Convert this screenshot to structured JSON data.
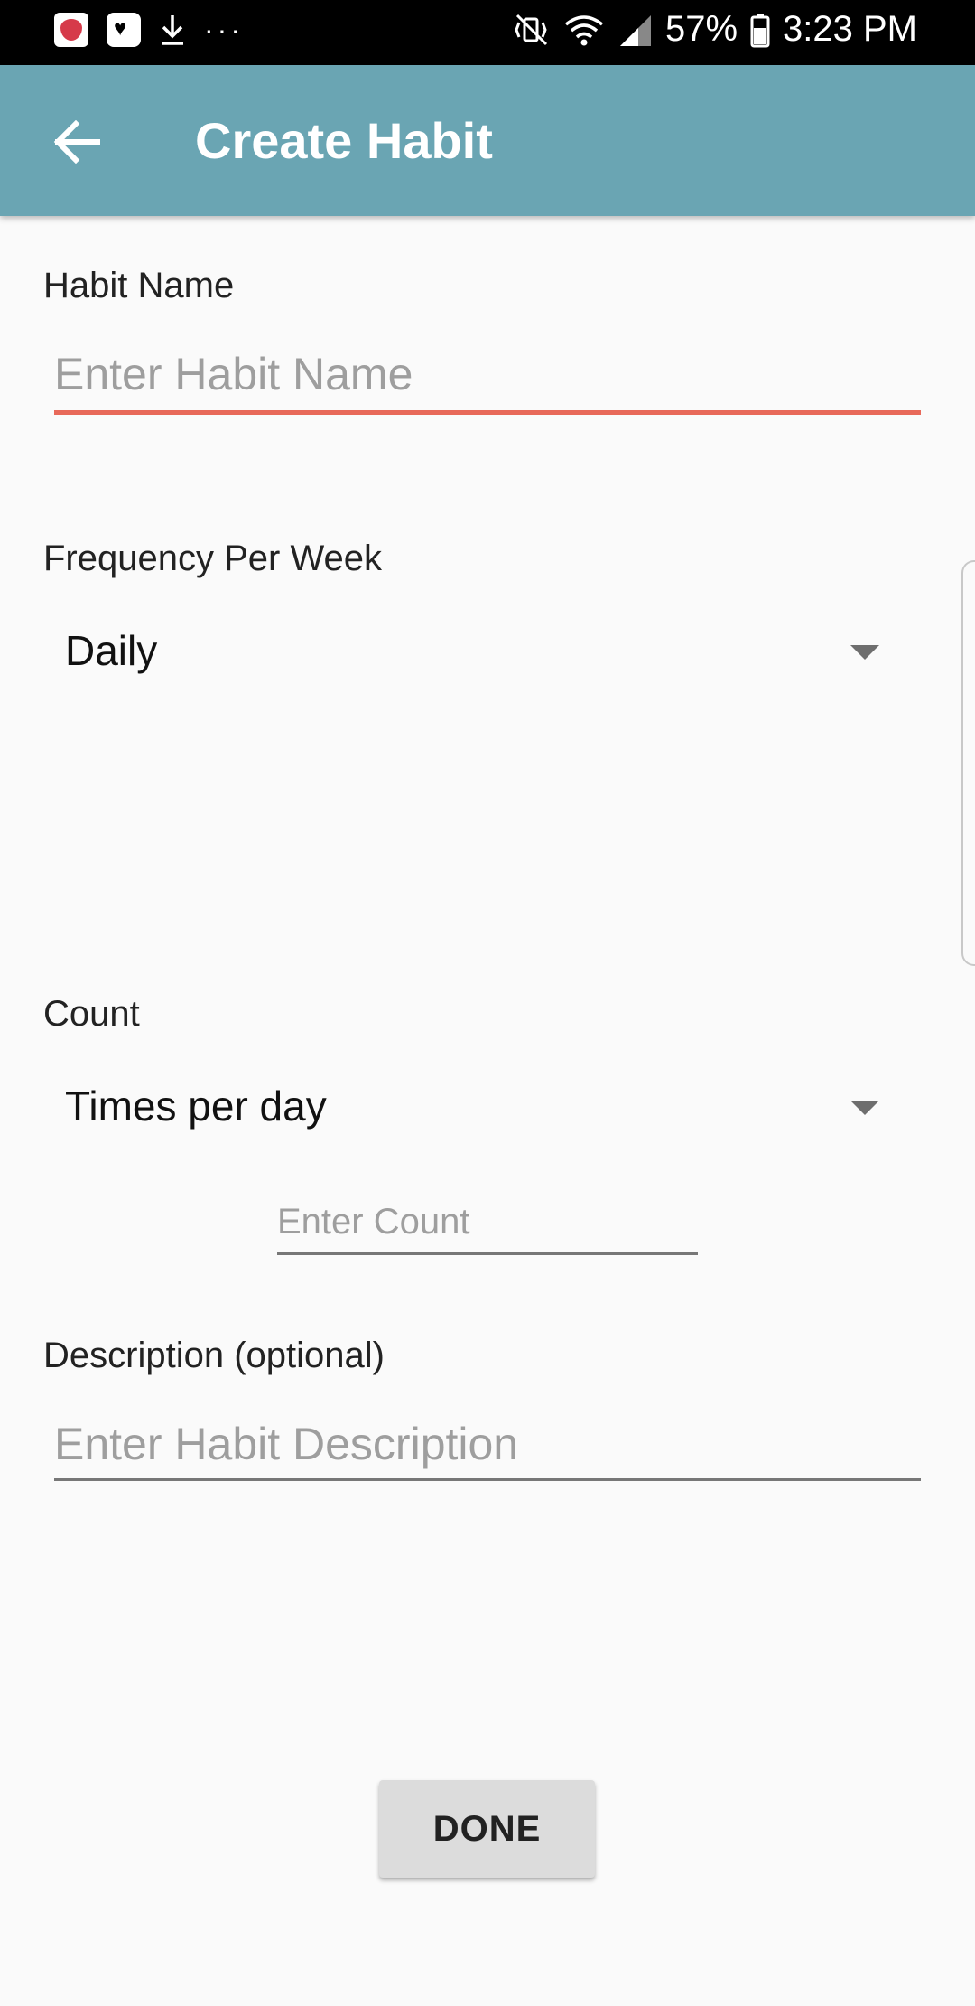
{
  "status_bar": {
    "icons_left": [
      "heart-app-icon",
      "heart-message-icon",
      "download-icon",
      "more-dots-icon"
    ],
    "more_text": "···",
    "battery": "57%",
    "time": "3:23 PM"
  },
  "app_bar": {
    "title": "Create Habit",
    "background_color": "#6aa5b3"
  },
  "form": {
    "habit_name": {
      "label": "Habit Name",
      "placeholder": "Enter Habit Name",
      "underline_color": "#e8695a"
    },
    "frequency": {
      "label": "Frequency Per Week",
      "selected": "Daily"
    },
    "count": {
      "label": "Count",
      "selected": "Times per day",
      "placeholder": "Enter Count"
    },
    "description": {
      "label": "Description (optional)",
      "placeholder": "Enter Habit Description"
    }
  },
  "done_button": {
    "label": "DONE"
  }
}
